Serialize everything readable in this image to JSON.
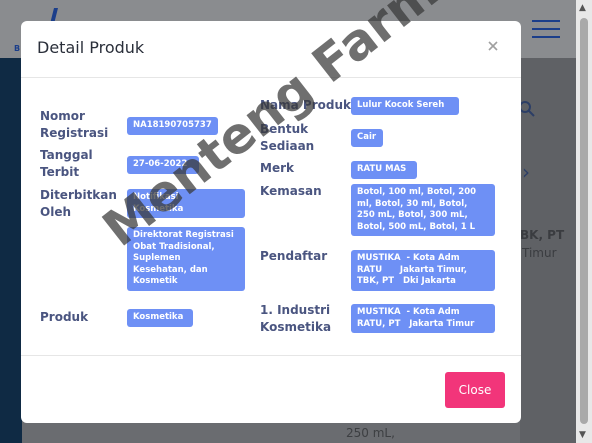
{
  "background": {
    "partial_text_1": "BK, PT",
    "partial_text_2": "Timur",
    "partial_text_3": "250 mL,",
    "logo_text": "B"
  },
  "modal": {
    "title": "Detail Produk",
    "close_button": "Close",
    "fields_left": [
      {
        "label": "Nomor\nRegistrasi",
        "value": "NA18190705737"
      },
      {
        "label": "Tanggal\nTerbit",
        "value": "27-06-2022"
      },
      {
        "label": "Diterbitkan\nOleh",
        "value": "Notifikasi\nKosmetika",
        "value2": "Direktorat Registrasi\nObat Tradisional,\nSuplemen\nKesehatan, dan\nKosmetik"
      },
      {
        "label": "Produk",
        "value": "Kosmetika"
      }
    ],
    "fields_right": [
      {
        "label": "Nama Produk",
        "value": "Lulur Kocok Sereh"
      },
      {
        "label": "Bentuk\nSediaan",
        "value": "Cair"
      },
      {
        "label": "Merk",
        "value": "RATU MAS"
      },
      {
        "label": "Kemasan",
        "value": "Botol, 100 ml, Botol, 200\nml, Botol, 30 ml, Botol,\n250 mL, Botol, 300 mL,\nBotol, 500 mL, Botol, 1 L"
      },
      {
        "label": "Pendaftar",
        "value": "MUSTIKA  - Kota Adm\nRATU      Jakarta Timur,\nTBK, PT   Dki Jakarta"
      },
      {
        "label": "1. Industri\nKosmetika",
        "value": "MUSTIKA  - Kota Adm\nRATU, PT   Jakarta Timur"
      }
    ]
  },
  "watermark": "Menteng Farma"
}
